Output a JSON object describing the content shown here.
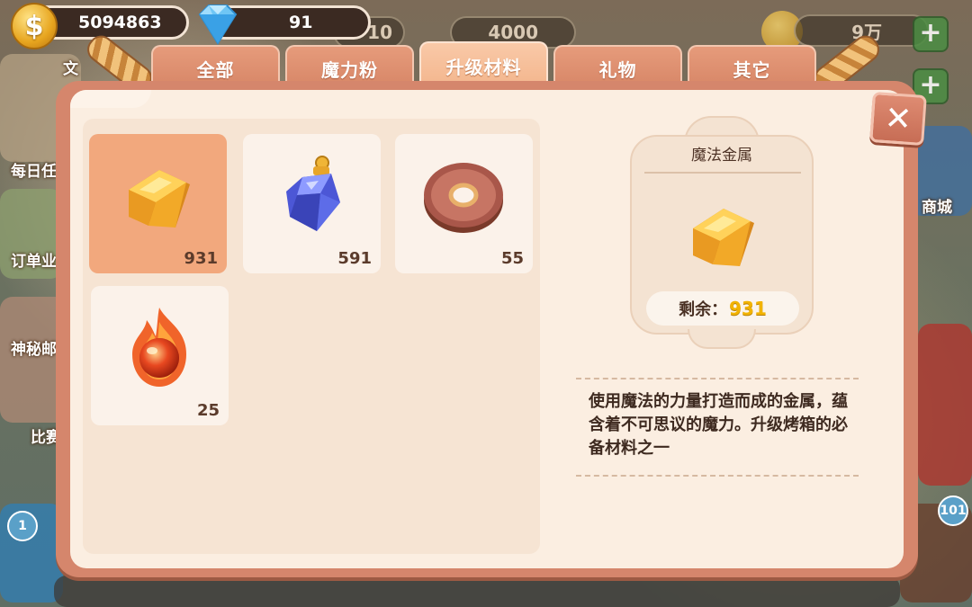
{
  "currency": {
    "coins": "5094863",
    "gems": "91"
  },
  "tabs": [
    {
      "label": "全部",
      "active": false
    },
    {
      "label": "魔力粉",
      "active": false
    },
    {
      "label": "升级材料",
      "active": true
    },
    {
      "label": "礼物",
      "active": false
    },
    {
      "label": "其它",
      "active": false
    }
  ],
  "items": [
    {
      "name": "magic-metal",
      "icon": "gold-ingot-icon",
      "count": "931",
      "selected": true
    },
    {
      "name": "magic-crystal",
      "icon": "blue-crystal-pendant-icon",
      "count": "591",
      "selected": false
    },
    {
      "name": "magic-ring",
      "icon": "brown-ring-icon",
      "count": "55",
      "selected": false
    },
    {
      "name": "fire-orb",
      "icon": "fire-orb-icon",
      "count": "25",
      "selected": false
    }
  ],
  "detail": {
    "title": "魔法金属",
    "remain_label": "剩余：",
    "remain_value": "931",
    "description": "使用魔法的力量打造而成的金属，蕴含着不可思议的魔力。升级烤箱的必备材料之一"
  },
  "background": {
    "left_labels": [
      "文",
      "每日任",
      "订单业",
      "神秘邮",
      "比赛"
    ],
    "right_labels": [
      "商城"
    ],
    "bubbles": [
      "1",
      "101"
    ],
    "bars": [
      "10",
      "4000",
      "9万"
    ]
  },
  "colors": {
    "panel": "#d5866c",
    "panel_inner": "#fbeee1",
    "tab": "#e69b7b",
    "tab_active": "#f3b58c",
    "selected_slot": "#f2a87d",
    "remain_value": "#f2b300"
  }
}
